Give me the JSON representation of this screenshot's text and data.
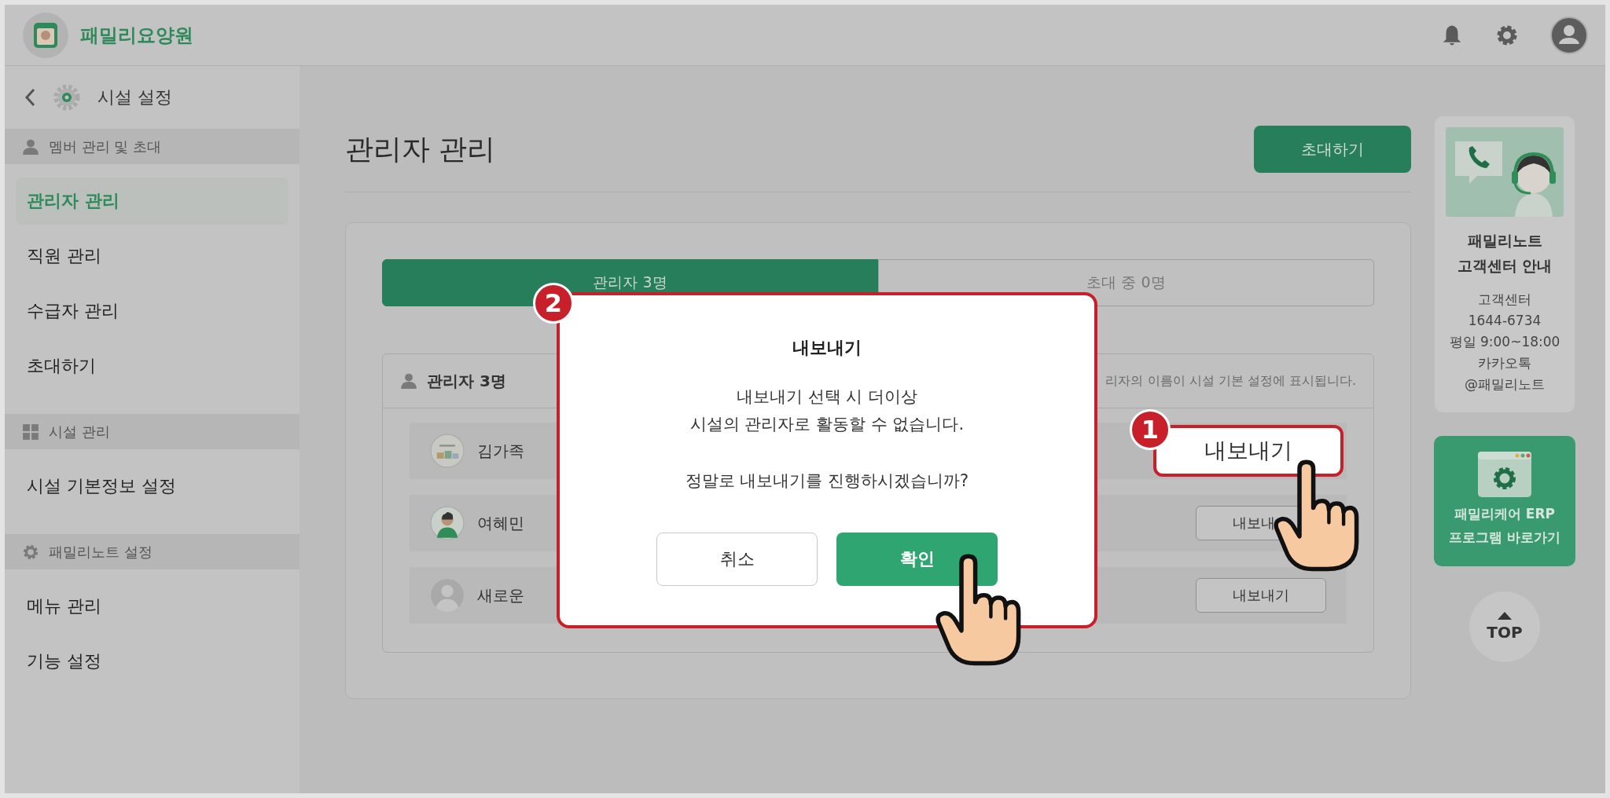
{
  "header": {
    "brand": "패밀리요양원"
  },
  "sidebar": {
    "title": "시설 설정",
    "sections": [
      {
        "label": "멤버 관리 및 초대",
        "kind": "person",
        "items": [
          {
            "label": "관리자 관리",
            "selected": true
          },
          {
            "label": "직원 관리",
            "selected": false
          },
          {
            "label": "수급자 관리",
            "selected": false
          },
          {
            "label": "초대하기",
            "selected": false
          }
        ]
      },
      {
        "label": "시설 관리",
        "kind": "grid",
        "items": [
          {
            "label": "시설 기본정보 설정",
            "selected": false
          }
        ]
      },
      {
        "label": "패밀리노트 설정",
        "kind": "gear",
        "items": [
          {
            "label": "메뉴 관리",
            "selected": false
          },
          {
            "label": "기능 설정",
            "selected": false
          }
        ]
      }
    ]
  },
  "page": {
    "title": "관리자 관리",
    "invite_button": "초대하기"
  },
  "tabs": [
    {
      "label": "관리자 3명",
      "selected": true
    },
    {
      "label": "초대 중 0명",
      "selected": false
    }
  ],
  "admin_list": {
    "title": "관리자 3명",
    "hint": "리자의 이름이 시설 기본 설정에 표시됩니다.",
    "rows": [
      {
        "name": "김가족",
        "kind": "logo",
        "button": "내보내기",
        "highlighted": true,
        "callout": "1"
      },
      {
        "name": "여혜민",
        "kind": "person",
        "button": "내보내",
        "highlighted": false
      },
      {
        "name": "새로운",
        "kind": "default",
        "button": "내보내기",
        "highlighted": false
      }
    ]
  },
  "support": {
    "title": [
      "패밀리노트",
      "고객센터 안내"
    ],
    "lines": [
      "고객센터",
      "1644-6734",
      "평일 9:00~18:00",
      "카카오톡",
      "@패밀리노트"
    ]
  },
  "erp_button": [
    "패밀리케어 ERP",
    "프로그램 바로가기"
  ],
  "top_button": "TOP",
  "modal": {
    "callout": "2",
    "title": "내보내기",
    "message": [
      "내보내기 선택 시 더이상",
      "시설의 관리자로 활동할 수 없습니다."
    ],
    "question": "정말로 내보내기를 진행하시겠습니까?",
    "buttons": [
      {
        "label": "취소",
        "kind": "secondary"
      },
      {
        "label": "확인",
        "kind": "primary"
      }
    ]
  }
}
